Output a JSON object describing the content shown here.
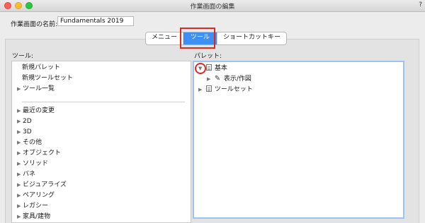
{
  "window": {
    "title": "作業画面の編集",
    "help": "?"
  },
  "name_field": {
    "label": "作業画面の名前:",
    "value": "Fundamentals 2019"
  },
  "tabs": [
    {
      "label": "メニュー",
      "active": false
    },
    {
      "label": "ツール",
      "active": true
    },
    {
      "label": "ショートカットキー",
      "active": false
    }
  ],
  "tools_panel": {
    "label": "ツール:",
    "items_top": [
      {
        "label": "新規パレット",
        "expandable": false
      },
      {
        "label": "新規ツールセット",
        "expandable": false
      },
      {
        "label": "ツール一覧",
        "expandable": true
      }
    ],
    "items_bottom": [
      {
        "label": "最近の変更",
        "expandable": true
      },
      {
        "label": "2D",
        "expandable": true
      },
      {
        "label": "3D",
        "expandable": true
      },
      {
        "label": "その他",
        "expandable": true
      },
      {
        "label": "オブジェクト",
        "expandable": true
      },
      {
        "label": "ソリッド",
        "expandable": true
      },
      {
        "label": "バネ",
        "expandable": true
      },
      {
        "label": "ビジュアライズ",
        "expandable": true
      },
      {
        "label": "ペアリング",
        "expandable": true
      },
      {
        "label": "レガシー",
        "expandable": true
      },
      {
        "label": "家具/建物",
        "expandable": true
      }
    ]
  },
  "palette_panel": {
    "label": "パレット:",
    "items": [
      {
        "label": "基本",
        "expanded": true,
        "icon": "palette-icon"
      },
      {
        "label": "表示/作図",
        "expanded": false,
        "icon": "pencil-icon"
      },
      {
        "label": "ツールセット",
        "expanded": false,
        "icon": "palette-icon"
      }
    ]
  },
  "colors": {
    "accent": "#3b8ff5",
    "highlight": "#e0281e"
  }
}
